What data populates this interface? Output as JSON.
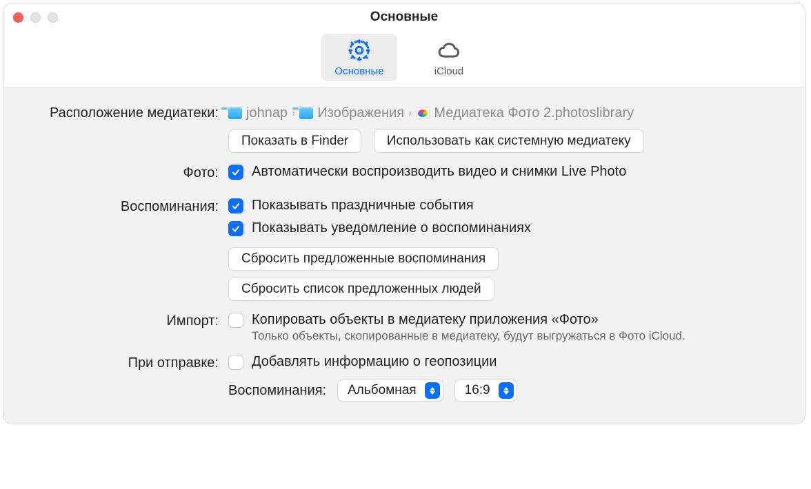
{
  "window": {
    "title": "Основные"
  },
  "tabs": {
    "general": "Основные",
    "icloud": "iCloud"
  },
  "rows": {
    "location_label": "Расположение медиатеки:",
    "breadcrumb": {
      "a": "johnap",
      "b": "Изображения",
      "c": "Медиатека Фото 2.photoslibrary"
    },
    "show_in_finder": "Показать в Finder",
    "use_as_system": "Использовать как системную медиатеку",
    "photo_label": "Фото:",
    "photo_autoplay": "Автоматически воспроизводить видео и снимки Live Photo",
    "memories_label": "Воспоминания:",
    "show_holidays": "Показывать праздничные события",
    "show_memory_notif": "Показывать уведомление о воспоминаниях",
    "reset_memories": "Сбросить предложенные воспоминания",
    "reset_people": "Сбросить список предложенных людей",
    "import_label": "Импорт:",
    "copy_items": "Копировать объекты в медиатеку приложения «Фото»",
    "copy_note": "Только объекты, скопированные в медиатеку, будут выгружаться в Фото iCloud.",
    "sharing_label": "При отправке:",
    "include_location": "Добавлять информацию о геопозиции",
    "orient_label": "Воспоминания:",
    "orient_value": "Альбомная",
    "aspect_value": "16:9"
  }
}
